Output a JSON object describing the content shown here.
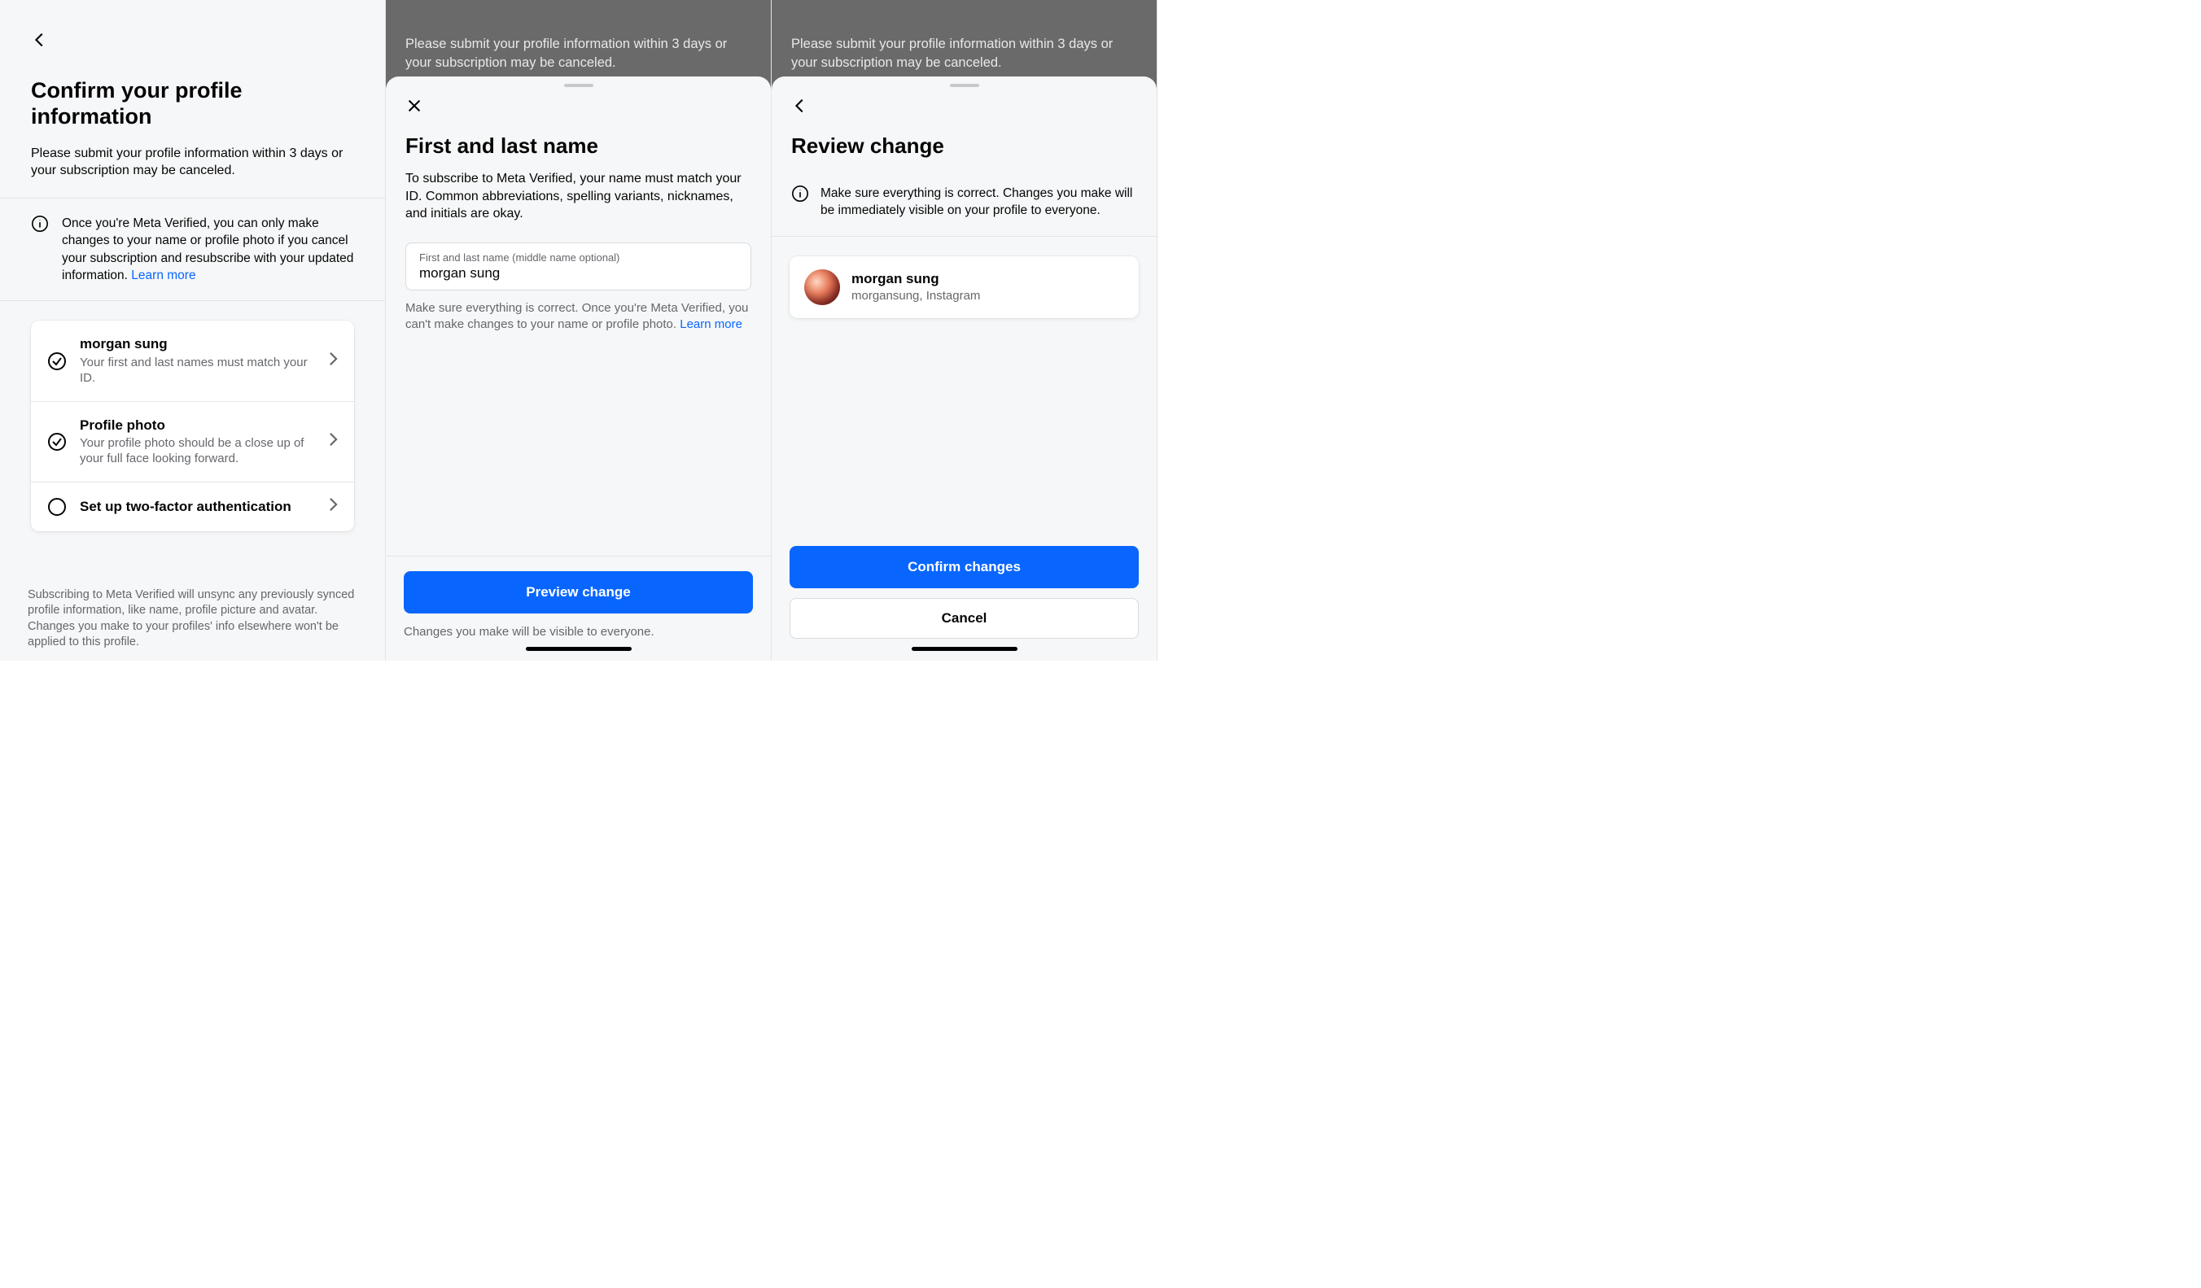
{
  "panel1": {
    "title": "Confirm your profile information",
    "subtitle": "Please submit your profile information within 3 days or your subscription may be canceled.",
    "info_text": "Once you're Meta Verified, you can only make changes to your name or profile photo if you cancel your subscription and resubscribe with your updated information. ",
    "info_link": "Learn more",
    "items": [
      {
        "title": "morgan sung",
        "sub": "Your first and last names must match your ID.",
        "status": "done"
      },
      {
        "title": "Profile photo",
        "sub": "Your profile photo should be a close up of your full face looking forward.",
        "status": "done"
      },
      {
        "title": "Set up two-factor authentication",
        "sub": "",
        "status": "todo"
      }
    ],
    "footer": "Subscribing to Meta Verified will unsync any previously synced profile information, like name, profile picture and avatar. Changes you make to your profiles' info elsewhere won't be applied to this profile."
  },
  "panel2": {
    "dim_text": "Please submit your profile information within 3 days or your subscription may be canceled.",
    "title": "First and last name",
    "desc": "To subscribe to Meta Verified, your name must match your ID. Common abbreviations, spelling variants, nicknames, and initials are okay.",
    "field_label": "First and last name (middle name optional)",
    "field_value": "morgan sung",
    "field_note": "Make sure everything is correct. Once you're Meta Verified, you can't make changes to your name or profile photo. ",
    "field_note_link": "Learn more",
    "primary_btn": "Preview change",
    "footer_note": "Changes you make will be visible to everyone."
  },
  "panel3": {
    "dim_text": "Please submit your profile information within 3 days or your subscription may be canceled.",
    "title": "Review change",
    "info": "Make sure everything is correct. Changes you make will be immediately visible on your profile to everyone.",
    "profile_name": "morgan sung",
    "profile_sub": "morgansung, Instagram",
    "confirm_btn": "Confirm changes",
    "cancel_btn": "Cancel"
  }
}
